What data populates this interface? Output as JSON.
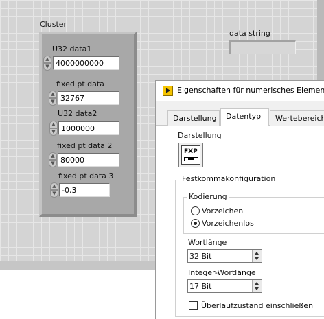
{
  "front_panel": {
    "cluster": {
      "label": "Cluster",
      "controls": [
        {
          "label": "U32 data1",
          "value": "4000000000"
        },
        {
          "label": "fixed pt data",
          "value": "32767"
        },
        {
          "label": "U32 data2",
          "value": "1000000"
        },
        {
          "label": "fixed pt data 2",
          "value": "80000"
        },
        {
          "label": "fixed pt data 3",
          "value": "-0,3"
        }
      ]
    },
    "string_indicator": {
      "label": "data string",
      "value": ""
    }
  },
  "dialog": {
    "title": "Eigenschaften für numerisches Element: f",
    "tabs": [
      {
        "label": "Darstellung",
        "active": false
      },
      {
        "label": "Datentyp",
        "active": true
      },
      {
        "label": "Wertebereich",
        "active": false
      }
    ],
    "representation_label": "Darstellung",
    "representation_icon_text": "FXP",
    "fixed_point_group_title": "Festkommakonfiguration",
    "encoding_group_title": "Kodierung",
    "encoding_options": [
      {
        "label": "Vorzeichen",
        "checked": false
      },
      {
        "label": "Vorzeichenlos",
        "checked": true
      }
    ],
    "word_length_label": "Wortlänge",
    "word_length_value": "32 Bit",
    "integer_word_length_label": "Integer-Wortlänge",
    "integer_word_length_value": "17 Bit",
    "overflow_checkbox_label": "Überlaufzustand einschließen",
    "overflow_checked": false
  }
}
